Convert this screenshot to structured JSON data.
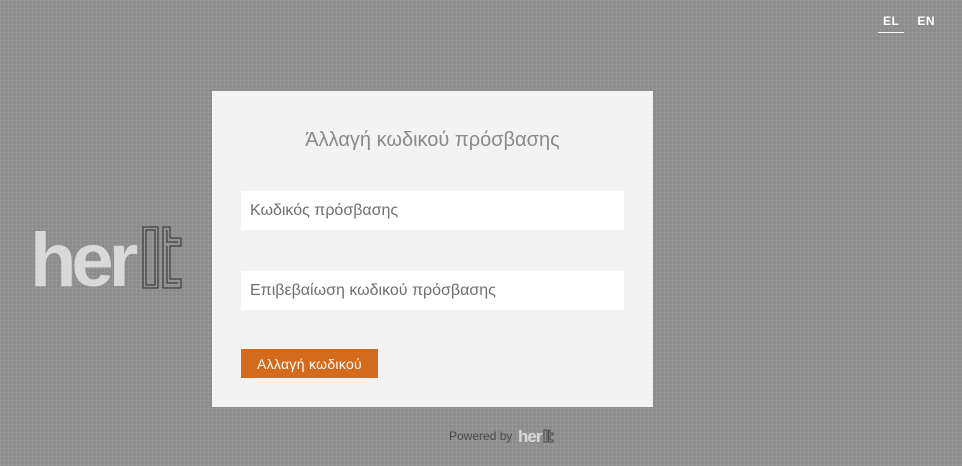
{
  "language_switch": {
    "items": [
      {
        "label": "EL",
        "active": true
      },
      {
        "label": "EN",
        "active": false
      }
    ]
  },
  "logo": {
    "text": "herit",
    "icon": "herit-logo"
  },
  "form": {
    "title": "Άλλαγή κωδικού πρόσβασης",
    "password_placeholder": "Κωδικός πρόσβασης",
    "password_value": "",
    "confirm_placeholder": "Επιβεβαίωση κωδικού πρόσβασης",
    "confirm_value": "",
    "submit_label": "Αλλαγή κωδικού"
  },
  "footer": {
    "powered_by": "Powered by",
    "brand": "herit"
  },
  "colors": {
    "accent": "#d46a1c",
    "background": "#8c8c8c",
    "card": "#f3f3f3"
  }
}
